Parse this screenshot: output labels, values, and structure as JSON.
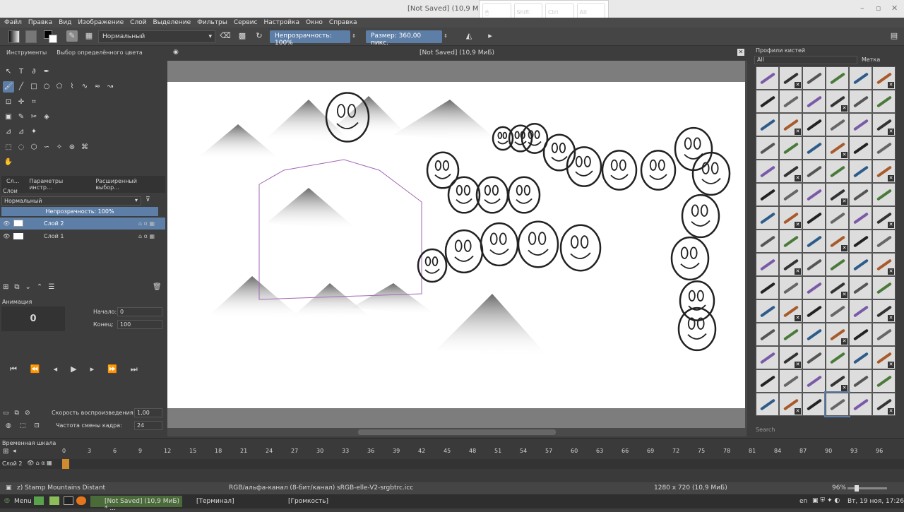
{
  "window": {
    "title": "[Not Saved]  (10,9 МиБ) *",
    "keys": [
      "Shift",
      "Ctrl",
      "Alt"
    ]
  },
  "menu": [
    "Файл",
    "Правка",
    "Вид",
    "Изображение",
    "Слой",
    "Выделение",
    "Фильтры",
    "Сервис",
    "Настройка",
    "Окно",
    "Справка"
  ],
  "toolbar": {
    "blend_mode": "Нормальный",
    "opacity": "Непрозрачность:  100%",
    "size": "Размер:  360,00  пикс."
  },
  "left_tabs": [
    "Инструменты",
    "Выбор определённого цвета"
  ],
  "tool_rows": [
    [
      "pointer-icon",
      "text-icon",
      "calligraphy-icon",
      "pen-icon"
    ],
    [
      "brush-icon",
      "line-icon",
      "rectangle-icon",
      "ellipse-icon",
      "polygon-icon",
      "polyline-icon",
      "bezier-icon",
      "freehand-path-icon",
      "dynamic-brush-icon"
    ],
    [
      "transform-icon",
      "move-icon",
      "crop-icon"
    ],
    [
      "gradient-icon",
      "color-picker-icon",
      "smart-patch-icon",
      "fill-icon"
    ],
    [
      "measure-icon",
      "assistant-icon",
      "reference-icon"
    ],
    [
      "rect-select-icon",
      "ellipse-select-icon",
      "polygon-select-icon",
      "freehand-select-icon",
      "contiguous-select-icon",
      "similar-select-icon",
      "bezier-select-icon"
    ],
    [
      "hand-icon"
    ]
  ],
  "layers_tabs": [
    "Сл...",
    "Параметры инстр...",
    "Расширенный выбор..."
  ],
  "layers": {
    "header": "Слои",
    "blend": "Нормальный",
    "opacity": "Непрозрачность:  100%",
    "items": [
      "Слой 2",
      "Слой 1"
    ]
  },
  "animation": {
    "title": "Анимация",
    "frame": "0",
    "start_label": "Начало:",
    "start": "0",
    "end_label": "Конец:",
    "end": "100",
    "speed_label": "Скорость воспроизведения:",
    "speed": "1,00",
    "rate_label": "Частота смены кадра:",
    "rate": "24"
  },
  "canvas_title": "[Not Saved]  (10,9 МиБ)",
  "brush_panel": {
    "title": "Профили кистей",
    "filter": "All",
    "tag": "Метка",
    "search": "Search"
  },
  "timeline": {
    "title": "Временная шкала",
    "layer": "Слой 2",
    "ticks": [
      "0",
      "3",
      "6",
      "9",
      "12",
      "15",
      "18",
      "21",
      "24",
      "27",
      "30",
      "33",
      "36",
      "39",
      "42",
      "45",
      "48",
      "51",
      "54",
      "57",
      "60",
      "63",
      "66",
      "69",
      "72",
      "75",
      "78",
      "81",
      "84",
      "87",
      "90",
      "93",
      "96"
    ]
  },
  "status": {
    "brush": "z) Stamp Mountains Distant",
    "color": "RGB/альфа-канал (8-бит/канал)  sRGB-elle-V2-srgbtrc.icc",
    "dims": "1280 x 720 (10,9 МиБ)",
    "zoom": "96%"
  },
  "taskbar": {
    "menu": "Menu",
    "tasks": [
      "[Not Saved]  (10,9 МиБ) * ...",
      "[Терминал]",
      "[Громкость]"
    ],
    "lang": "en",
    "clock": "Вт, 19 ноя, 17:26"
  },
  "colors": {
    "accent": "#5d7ea6",
    "panel": "#3d3d3d"
  }
}
